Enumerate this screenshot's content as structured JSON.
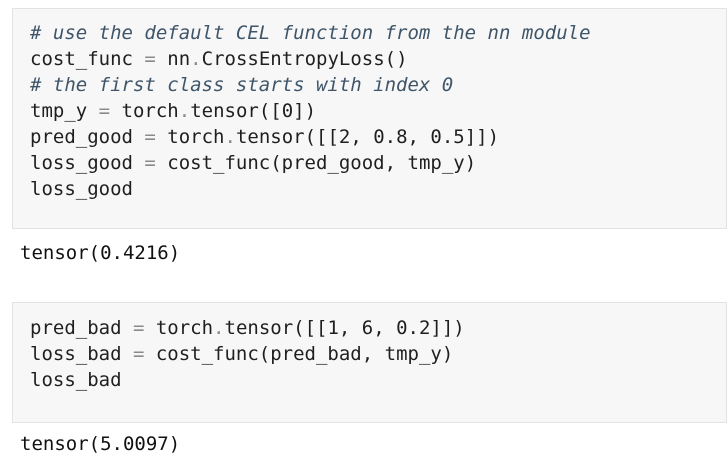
{
  "cells": [
    {
      "lines": [
        {
          "parts": [
            {
              "t": "# use the default CEL function from the nn module",
              "c": "comment"
            }
          ]
        },
        {
          "parts": [
            {
              "t": "cost_func "
            },
            {
              "t": "=",
              "c": "op"
            },
            {
              "t": " nn"
            },
            {
              "t": ".",
              "c": "op"
            },
            {
              "t": "CrossEntropyLoss()"
            }
          ]
        },
        {
          "parts": [
            {
              "t": "# the first class starts with index 0",
              "c": "comment"
            }
          ]
        },
        {
          "parts": [
            {
              "t": "tmp_y "
            },
            {
              "t": "=",
              "c": "op"
            },
            {
              "t": " torch"
            },
            {
              "t": ".",
              "c": "op"
            },
            {
              "t": "tensor([0])"
            }
          ]
        },
        {
          "parts": [
            {
              "t": "pred_good "
            },
            {
              "t": "=",
              "c": "op"
            },
            {
              "t": " torch"
            },
            {
              "t": ".",
              "c": "op"
            },
            {
              "t": "tensor([[2, 0.8, 0.5]])"
            }
          ]
        },
        {
          "parts": [
            {
              "t": "loss_good "
            },
            {
              "t": "=",
              "c": "op"
            },
            {
              "t": " cost_func(pred_good, tmp_y)"
            }
          ]
        },
        {
          "parts": [
            {
              "t": "loss_good"
            }
          ]
        }
      ],
      "output": "tensor(0.4216)"
    },
    {
      "lines": [
        {
          "parts": [
            {
              "t": "pred_bad "
            },
            {
              "t": "=",
              "c": "op"
            },
            {
              "t": " torch"
            },
            {
              "t": ".",
              "c": "op"
            },
            {
              "t": "tensor([[1, 6, 0.2]])"
            }
          ]
        },
        {
          "parts": [
            {
              "t": "loss_bad "
            },
            {
              "t": "=",
              "c": "op"
            },
            {
              "t": " cost_func(pred_bad, tmp_y)"
            }
          ]
        },
        {
          "parts": [
            {
              "t": "loss_bad"
            }
          ]
        }
      ],
      "output": "tensor(5.0097)"
    }
  ]
}
